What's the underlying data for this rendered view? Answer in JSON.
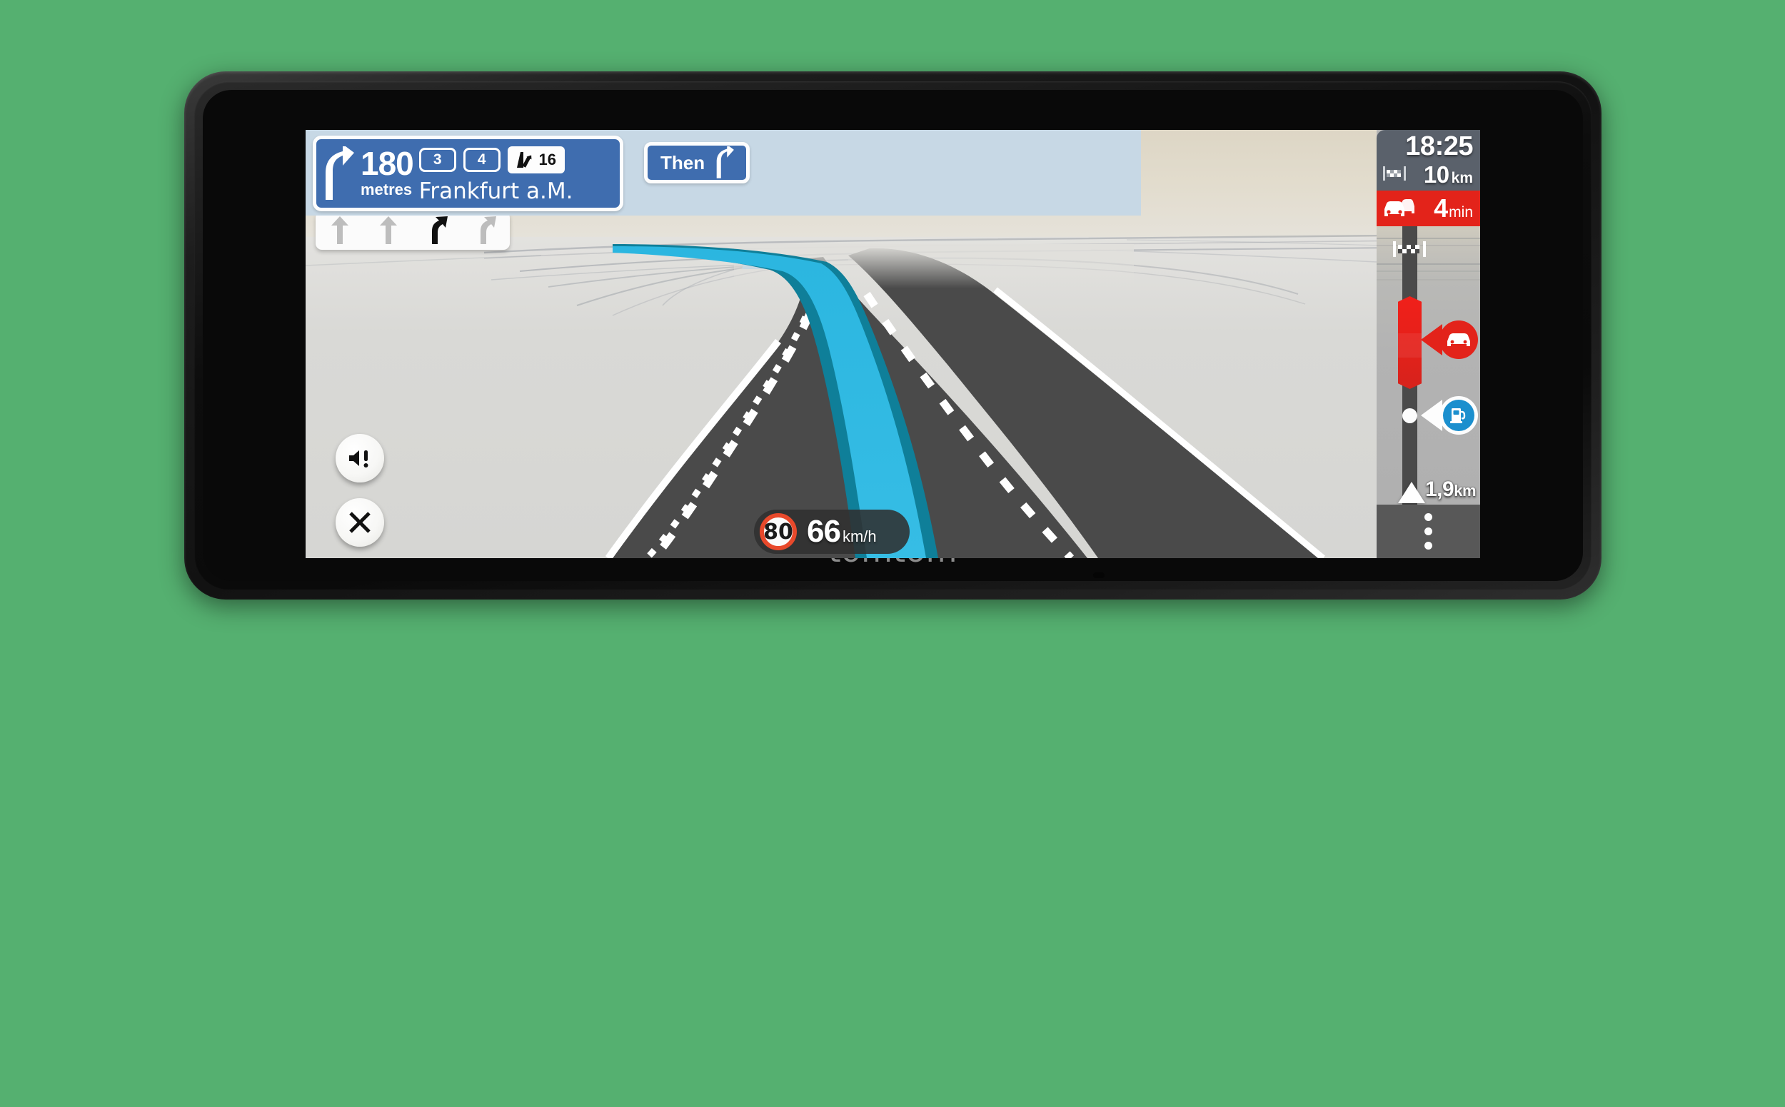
{
  "device": {
    "brand_logo": "tomtom",
    "type": "gps-navigation-device"
  },
  "screen": {
    "instruction": {
      "distance_value": "180",
      "distance_unit": "metres",
      "maneuver_icon": "turn-slight-right-arrow",
      "destination": "Frankfurt a.M.",
      "lane_shields": [
        "3",
        "4"
      ],
      "exit_badge": {
        "icon": "motorway-exit-icon",
        "number": "16"
      }
    },
    "then_instruction": {
      "label": "Then",
      "maneuver_icon": "turn-slight-right-arrow"
    },
    "lane_guidance": {
      "lanes": [
        {
          "icon": "arrow-straight",
          "active": false
        },
        {
          "icon": "arrow-straight",
          "active": false
        },
        {
          "icon": "arrow-slight-right",
          "active": true
        },
        {
          "icon": "arrow-slight-right",
          "active": false
        }
      ]
    },
    "speed_panel": {
      "speed_limit": "80",
      "current_speed": "66",
      "speed_unit": "km/h"
    },
    "route_bar": {
      "arrival_time": "18:25",
      "remaining_distance": "10",
      "remaining_distance_unit": "km",
      "destination_flag_icon": "checkered-flag-icon",
      "traffic_delay_value": "4",
      "traffic_delay_unit": "min",
      "traffic_icon": "traffic-jam-cars-icon",
      "incidents": [
        {
          "type": "traffic-jam",
          "icon": "car-icon",
          "color": "#e3231a"
        },
        {
          "type": "fuel-station",
          "icon": "fuel-pump-icon",
          "color": "#1b8fce"
        }
      ],
      "next_event_distance": "1,9",
      "next_event_distance_unit": "km",
      "vehicle_marker_icon": "vehicle-arrow-icon",
      "menu_icon": "more-options-dots-icon"
    },
    "controls": [
      {
        "name": "sound-alert-button",
        "icon": "speaker-alert-icon"
      },
      {
        "name": "close-button",
        "icon": "close-x-icon"
      }
    ],
    "map": {
      "route_line_color": "#2bb6e0",
      "road_surface_color": "#4a4a4a",
      "terrain_color": "#d9d9d6",
      "sky_color": "#ddd6c5",
      "water_color": "#b3d2e6"
    }
  },
  "colors": {
    "sign_blue": "#3f6daf",
    "header_band": "#c7d8e5",
    "traffic_red": "#e3231a",
    "eta_panel": "#5a616b",
    "fuel_blue": "#1b8fce",
    "speed_limit_ring": "#e8492b"
  }
}
